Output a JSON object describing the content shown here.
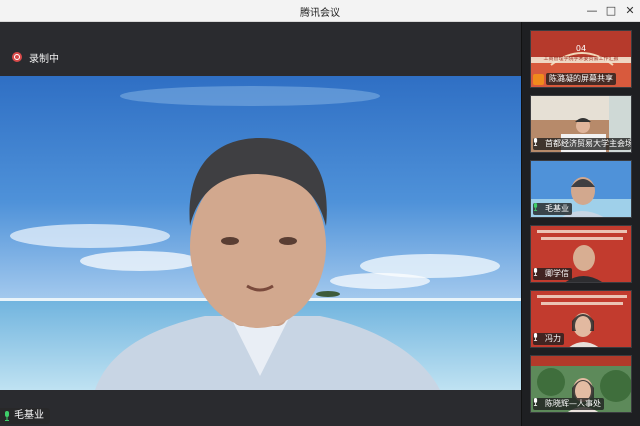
{
  "window": {
    "title": "腾讯会议"
  },
  "recording": {
    "label": "录制中"
  },
  "main_speaker": {
    "name": "毛基业"
  },
  "participants": [
    {
      "label": "陈潞凝的屏幕共享",
      "slide_number": "04",
      "slide_caption": "工商管理学院学术委员会工作汇报"
    },
    {
      "label": "首都经济贸易大学主会场"
    },
    {
      "label": "毛基业"
    },
    {
      "label": "卿学信"
    },
    {
      "label": "冯力"
    },
    {
      "label": "陈晓辉—人事处"
    }
  ],
  "icons": {
    "record": "record-dot-icon",
    "mic": "mic-icon",
    "screen_share": "screen-share-icon",
    "minimize": "minimize-icon",
    "maximize": "maximize-icon",
    "close": "close-icon"
  },
  "colors": {
    "record_red": "#d84a4a",
    "mic_green": "#3fcf6a",
    "share_orange": "#f08a1c"
  }
}
